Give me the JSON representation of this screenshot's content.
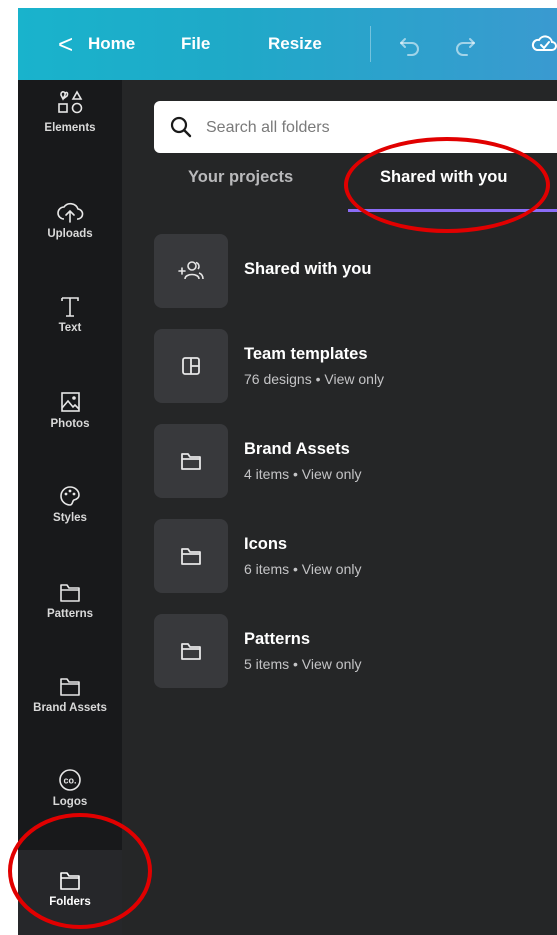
{
  "topbar": {
    "back_glyph": "<",
    "home_label": "Home",
    "file_label": "File",
    "resize_label": "Resize",
    "icons": [
      "undo-icon",
      "redo-icon",
      "cloud-saved-icon"
    ]
  },
  "sidebar": {
    "items": [
      {
        "label": "Elements",
        "icon": "elements-icon"
      },
      {
        "label": "Uploads",
        "icon": "upload-cloud-icon"
      },
      {
        "label": "Text",
        "icon": "text-icon"
      },
      {
        "label": "Photos",
        "icon": "photo-icon"
      },
      {
        "label": "Styles",
        "icon": "palette-icon"
      },
      {
        "label": "Patterns",
        "icon": "folder-icon"
      },
      {
        "label": "Brand Assets",
        "icon": "folder-icon"
      },
      {
        "label": "Logos",
        "icon": "co-logo-icon"
      },
      {
        "label": "Folders",
        "icon": "folder-icon",
        "active": true
      }
    ]
  },
  "search": {
    "placeholder": "Search all folders",
    "value": ""
  },
  "tabs": [
    {
      "label": "Your projects",
      "active": false
    },
    {
      "label": "Shared with you",
      "active": true
    }
  ],
  "folders": [
    {
      "title": "Shared with you",
      "subtitle": "",
      "icon": "shared-users-icon"
    },
    {
      "title": "Team templates",
      "subtitle": "76 designs • View only",
      "icon": "template-icon"
    },
    {
      "title": "Brand Assets",
      "subtitle": "4 items • View only",
      "icon": "folder-icon"
    },
    {
      "title": "Icons",
      "subtitle": "6 items • View only",
      "icon": "folder-icon"
    },
    {
      "title": "Patterns",
      "subtitle": "5 items • View only",
      "icon": "folder-icon"
    }
  ],
  "colors": {
    "topbar_gradient_start": "#19b3cc",
    "topbar_gradient_end": "#3a9ad0",
    "sidebar_bg": "#18191b",
    "panel_bg": "#252627",
    "tab_underline": "#8b6cf6",
    "annotation": "#e10000"
  }
}
